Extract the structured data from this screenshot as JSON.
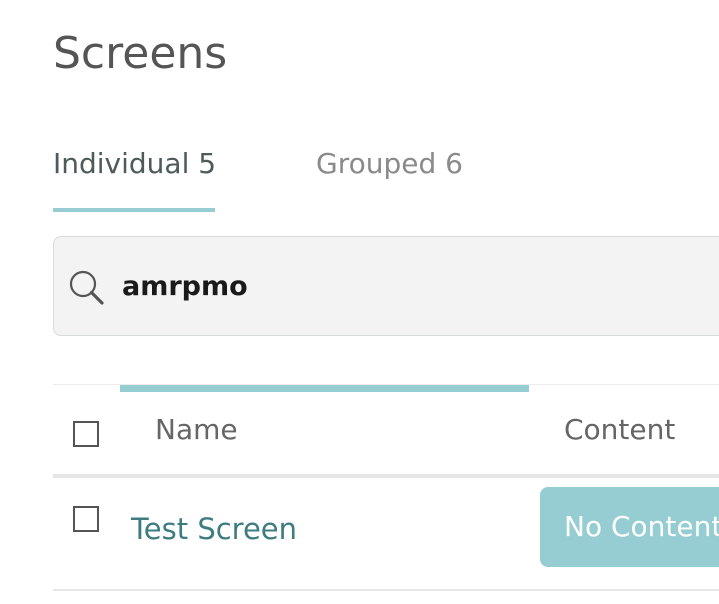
{
  "page": {
    "title": "Screens"
  },
  "tabs": [
    {
      "label": "Individual 5",
      "active": true
    },
    {
      "label": "Grouped 6",
      "active": false
    }
  ],
  "search": {
    "value": "amrpmo",
    "icon": "search-icon"
  },
  "table": {
    "columns": [
      "Name",
      "Content"
    ],
    "sorted_by": "Name",
    "rows": [
      {
        "name": "Test Screen",
        "content": "No Content"
      }
    ]
  },
  "colors": {
    "accent": "#95cdd2",
    "link": "#3e7c80",
    "search_bg": "#f2f3f2"
  }
}
